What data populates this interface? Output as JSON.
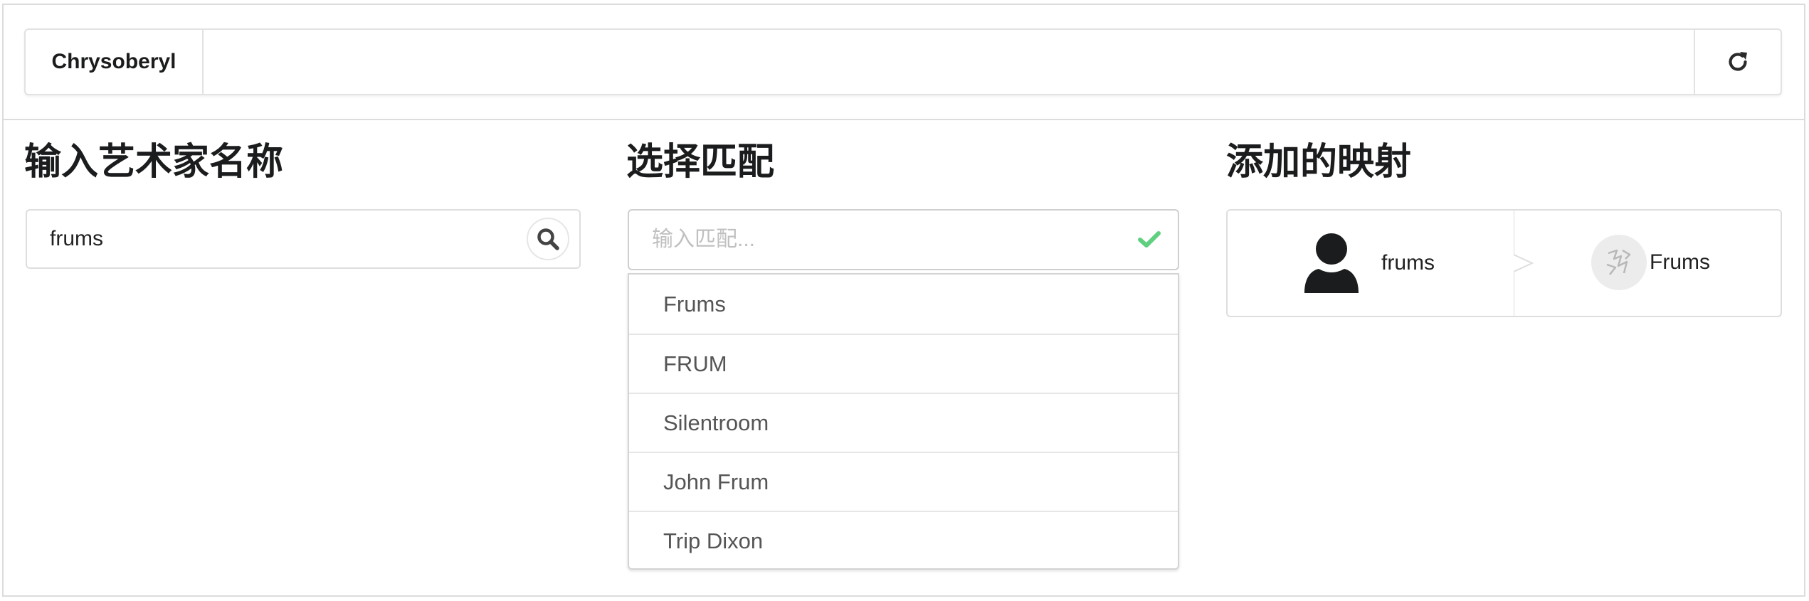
{
  "app": {
    "title": "Chrysoberyl"
  },
  "toolbar": {
    "refresh_icon": "refresh-icon"
  },
  "columns": {
    "artist_input": {
      "title": "输入艺术家名称",
      "value": "frums",
      "search_icon": "search-icon"
    },
    "select_match": {
      "title": "选择匹配",
      "placeholder": "输入匹配...",
      "confirm_icon": "check-icon",
      "accent_color": "#5fcf80",
      "options": [
        "Frums",
        "FRUM",
        "Silentroom",
        "John Frum",
        "Trip Dixon"
      ]
    },
    "mappings": {
      "title": "添加的映射",
      "items": [
        {
          "source": "frums",
          "source_icon": "user-icon",
          "target": "Frums",
          "target_icon": "artist-avatar"
        }
      ]
    }
  }
}
